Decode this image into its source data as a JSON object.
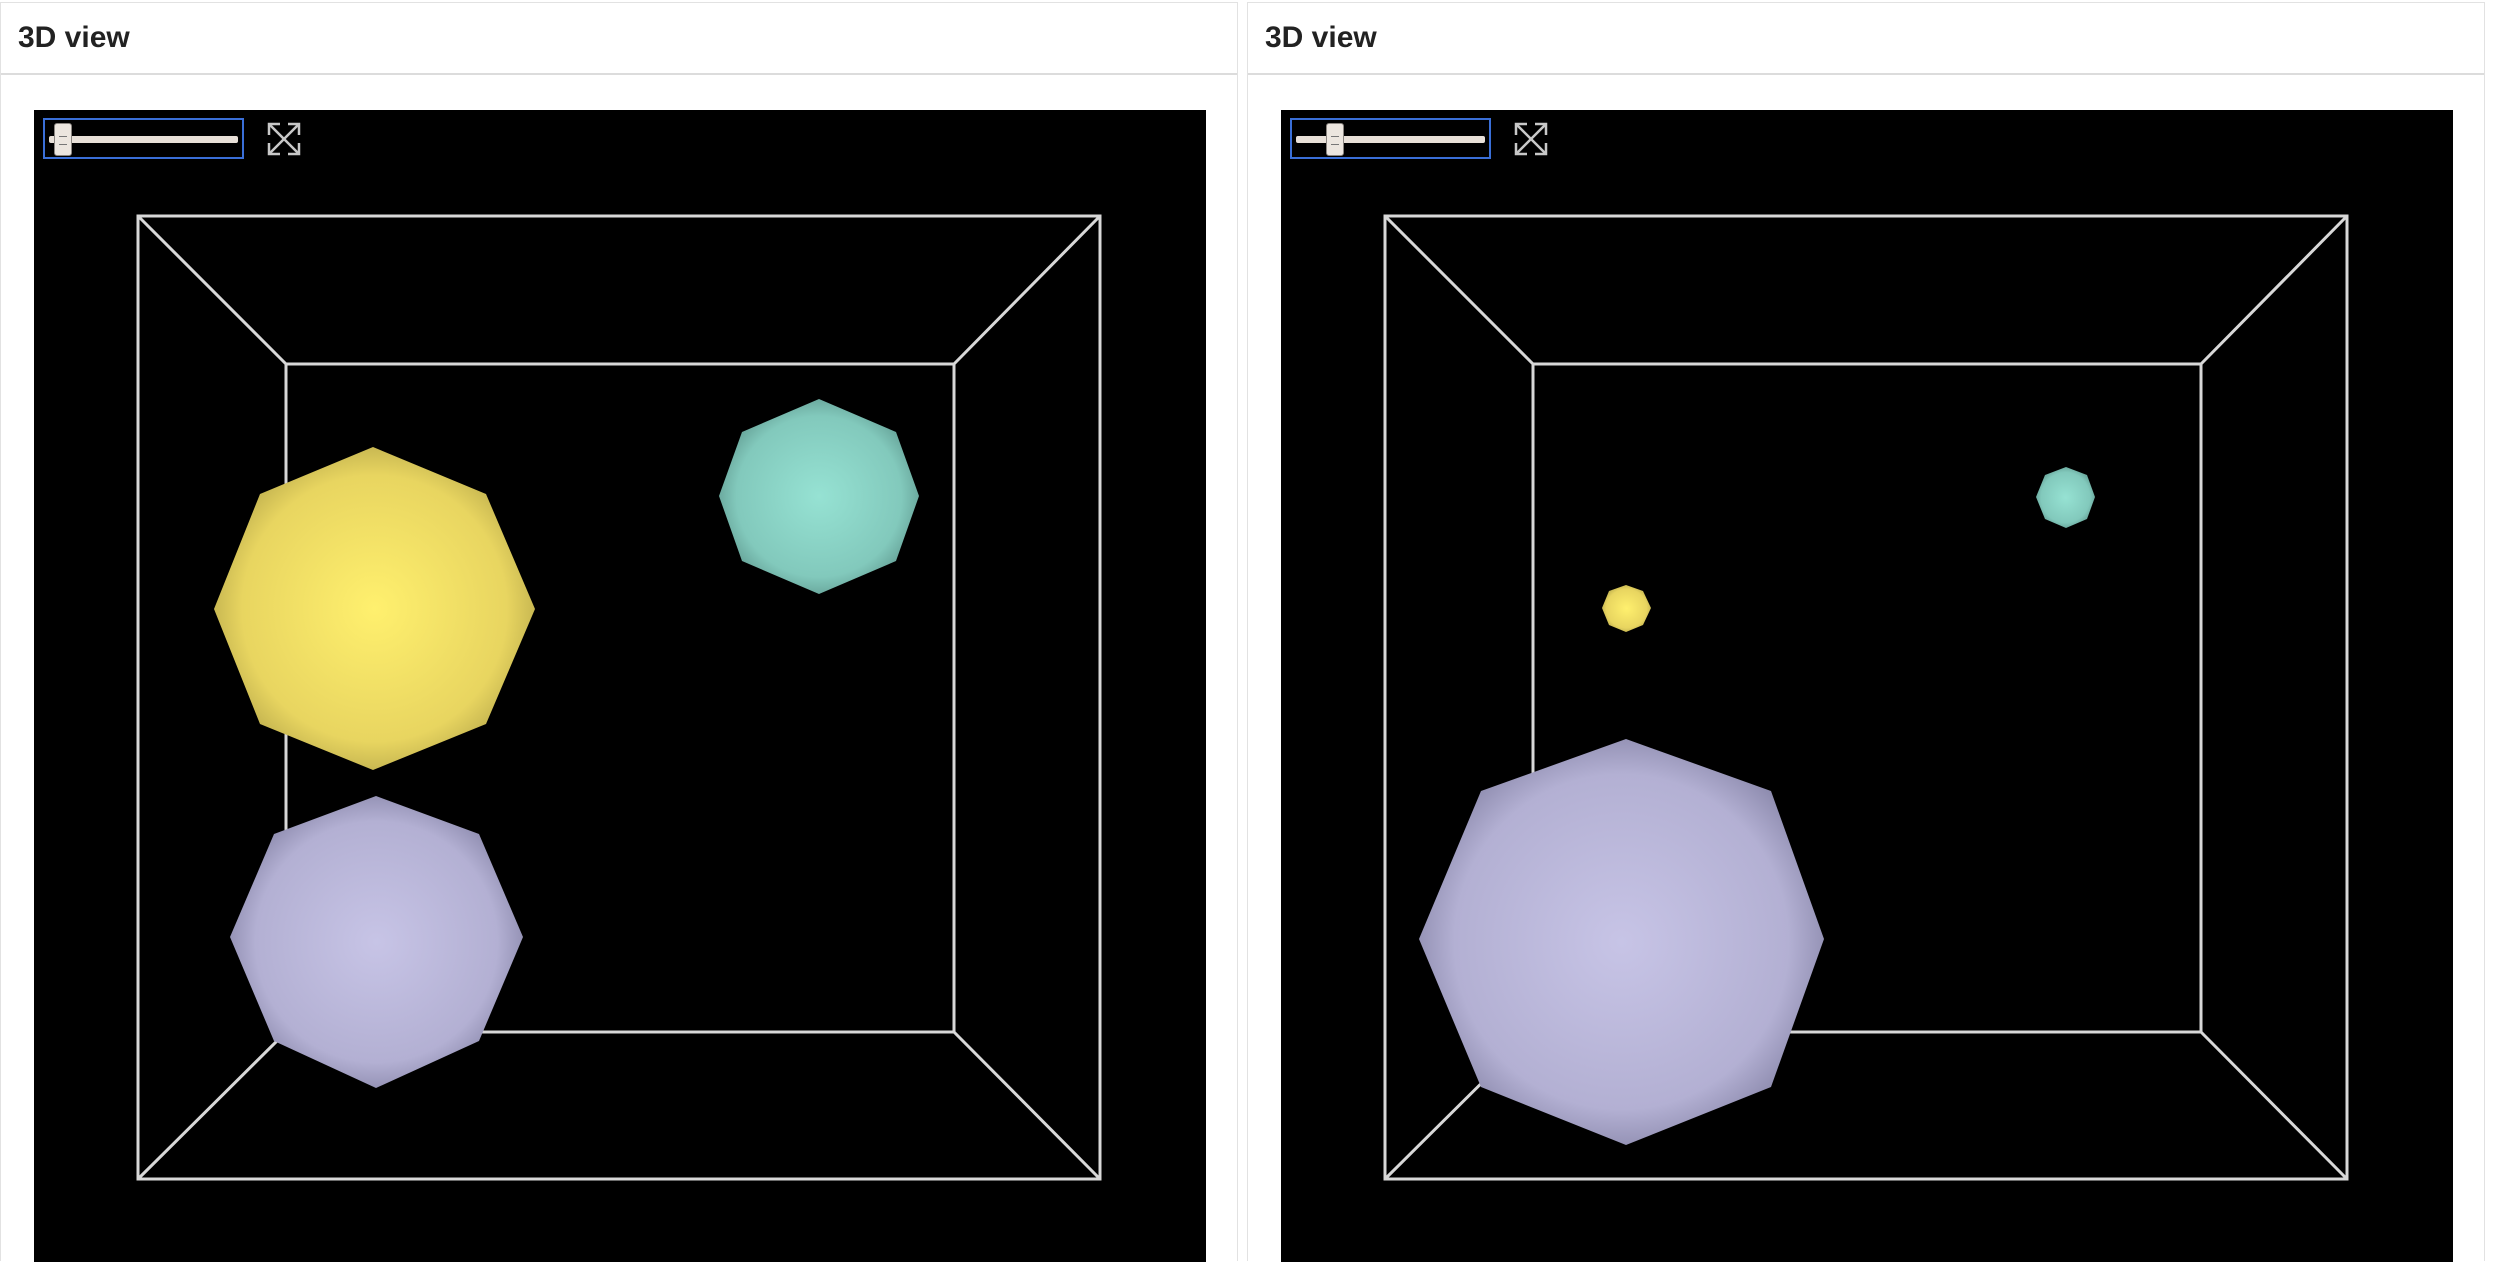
{
  "panes": [
    {
      "title": "3D view",
      "slider_value": 0.04,
      "fullscreen_icon": "expand-arrows-icon"
    },
    {
      "title": "3D view",
      "slider_value": 0.18,
      "fullscreen_icon": "expand-arrows-icon"
    }
  ],
  "colors": {
    "sphere_yellow": "#f5e56a",
    "sphere_teal": "#8cd6c8",
    "sphere_lavender": "#bdbadb",
    "wireframe": "#d8d8d8",
    "viewport_background": "#000000",
    "slider_focus": "#3a6fd8"
  }
}
